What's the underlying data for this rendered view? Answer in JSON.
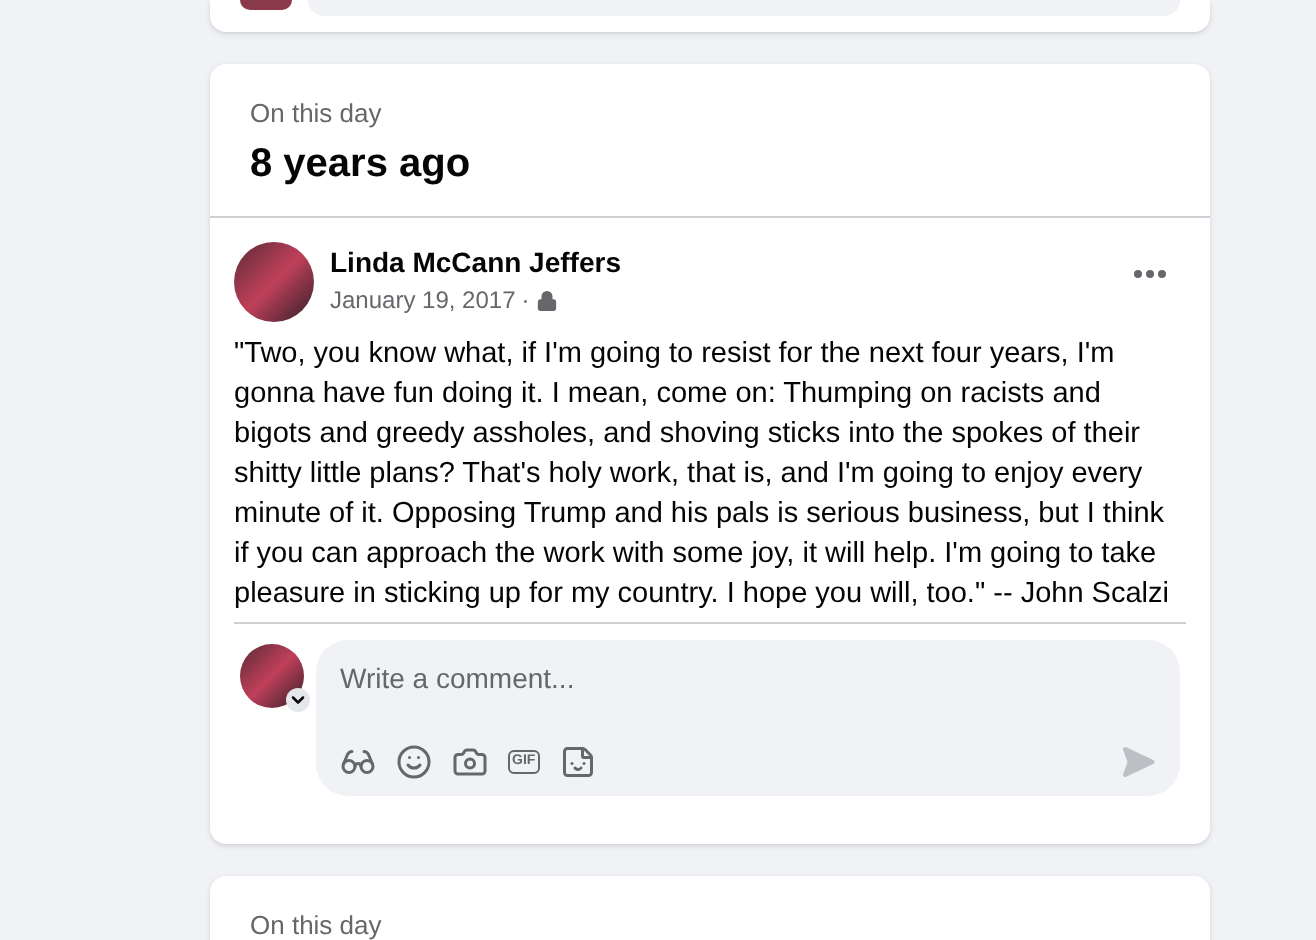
{
  "memory": {
    "label": "On this day",
    "heading": "8 years ago",
    "post": {
      "author": "Linda McCann Jeffers",
      "date": "January 19, 2017",
      "separator": "·",
      "private": true,
      "text": "\"Two, you know what, if I'm going to resist for the next four years, I'm gonna have fun doing it. I mean, come on: Thumping on racists and bigots and greedy assholes, and shoving sticks into the spokes of their shitty little plans? That's holy work, that is, and I'm going to enjoy every minute of it. Opposing Trump and his pals is serious business, but I think if you can approach the work with some joy, it will help. I'm going to take pleasure in sticking up for my country. I hope you will, too.\" -- John Scalzi"
    },
    "comment": {
      "placeholder": "Write a comment...",
      "gif_label": "GIF"
    }
  },
  "next_memory": {
    "label": "On this day"
  }
}
